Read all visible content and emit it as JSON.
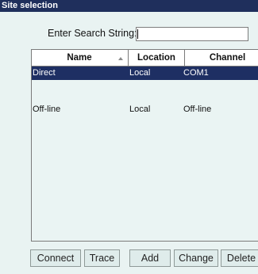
{
  "window": {
    "title": "Site selection"
  },
  "search": {
    "label": "Enter Search String:",
    "value": "",
    "placeholder": ""
  },
  "table": {
    "columns": [
      "Name",
      "Location",
      "Channel"
    ],
    "rows": [
      {
        "name": "Direct",
        "location": "Local",
        "channel": "COM1",
        "selected": true
      },
      {
        "name": "",
        "location": "",
        "channel": "",
        "selected": false
      },
      {
        "name": "Off-line",
        "location": "Local",
        "channel": "Off-line",
        "selected": false
      }
    ]
  },
  "buttons": {
    "connect": "Connect",
    "trace": "Trace",
    "add": "Add",
    "change": "Change",
    "delete": "Delete"
  },
  "colors": {
    "titlebar": "#1f2f5c",
    "selection": "#1e2f63",
    "panel": "#e9f3f2"
  }
}
